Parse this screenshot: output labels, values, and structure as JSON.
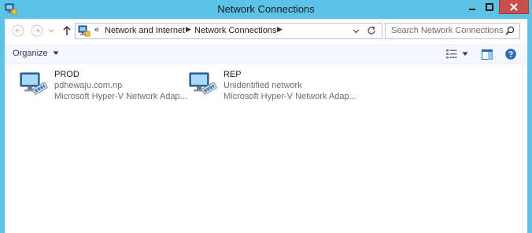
{
  "window": {
    "title": "Network Connections",
    "app_icon": "network-connections-icon"
  },
  "titlebar": {
    "minimize_icon": "minimize-icon",
    "maximize_icon": "maximize-icon",
    "close_icon": "close-icon",
    "close_color": "#c7504e",
    "accent_color": "#5bc3e6"
  },
  "address": {
    "overflow": "«",
    "breadcrumbs": [
      "Network and Internet",
      "Network Connections"
    ],
    "search_placeholder": "Search Network Connections"
  },
  "commandbar": {
    "organize_label": "Organize"
  },
  "connections": [
    {
      "name": "PROD",
      "network": "pdhewaju.com.np",
      "adapter": "Microsoft Hyper-V Network Adap..."
    },
    {
      "name": "REP",
      "network": "Unidentified network",
      "adapter": "Microsoft Hyper-V Network Adap..."
    }
  ]
}
